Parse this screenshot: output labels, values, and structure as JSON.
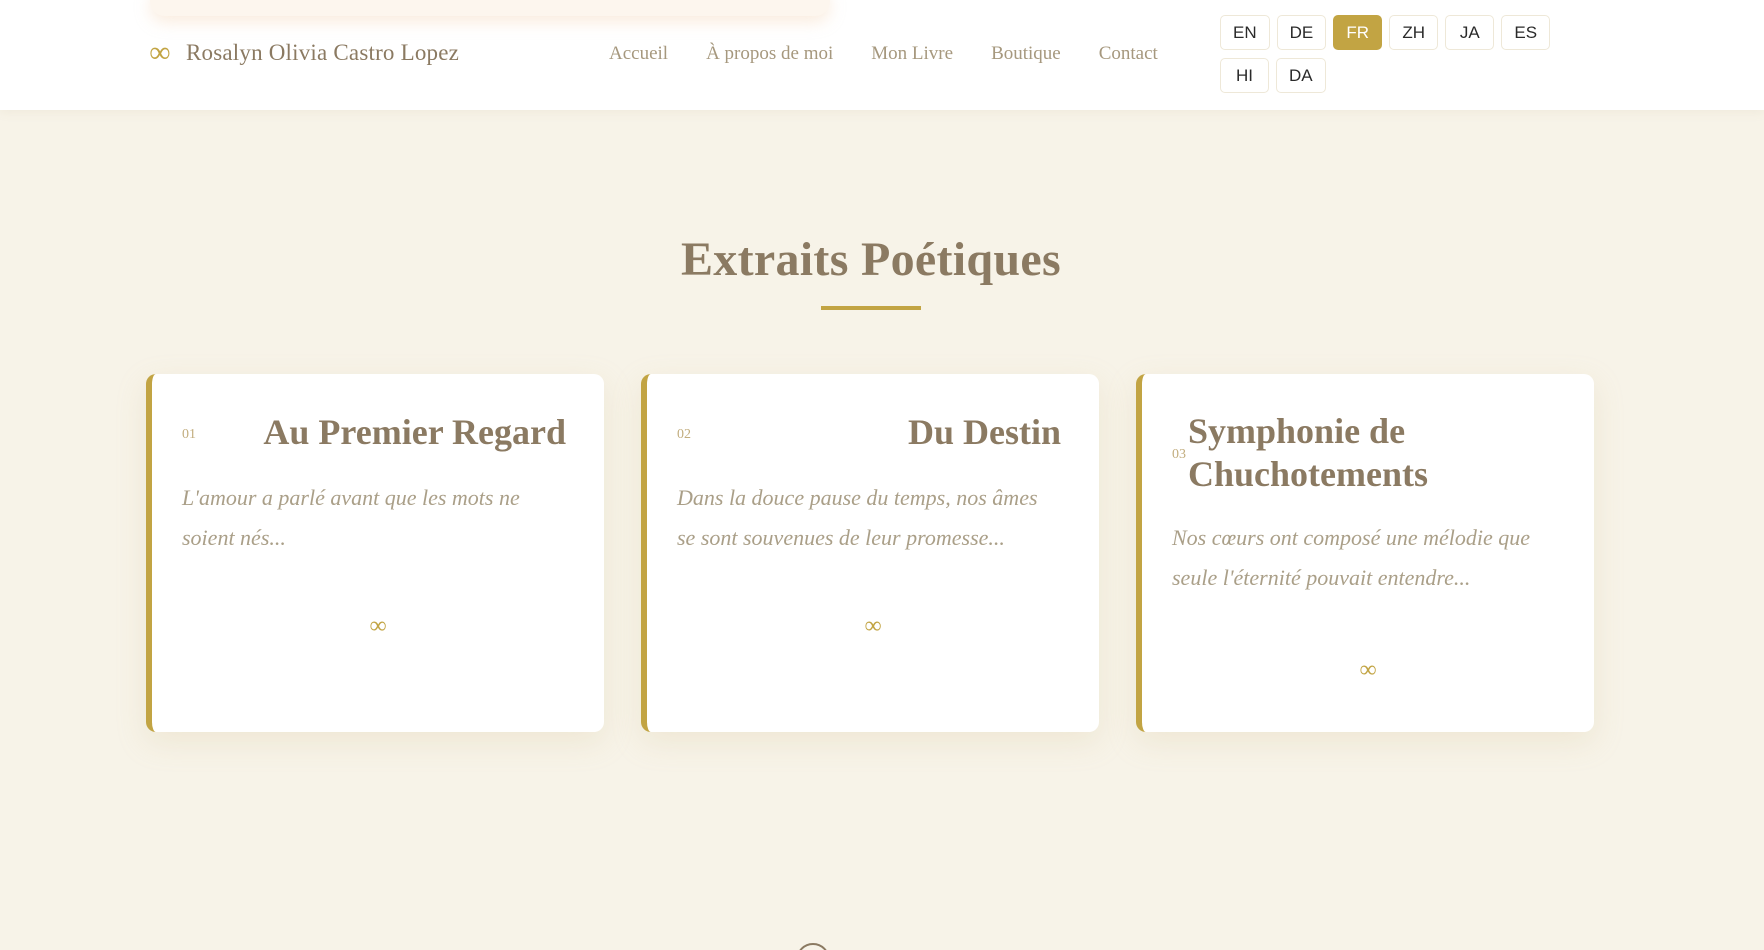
{
  "header": {
    "brand_icon": "infinity-icon",
    "brand_name": "Rosalyn Olivia Castro Lopez",
    "nav": [
      "Accueil",
      "À propos de moi",
      "Mon Livre",
      "Boutique",
      "Contact"
    ],
    "languages": [
      "EN",
      "DE",
      "FR",
      "ZH",
      "JA",
      "ES",
      "HI",
      "DA"
    ],
    "active_language": "FR"
  },
  "section": {
    "title": "Extraits Poétiques",
    "cards": [
      {
        "number": "01",
        "title": "Au Premier Regard",
        "excerpt": "L'amour a parlé avant que les mots ne soient nés...",
        "icon": "infinity-icon"
      },
      {
        "number": "02",
        "title": "Du Destin",
        "excerpt": "Dans la douce pause du temps, nos âmes se sont souvenues de leur promesse...",
        "icon": "infinity-icon"
      },
      {
        "number": "03",
        "title": "Symphonie de Chuchotements",
        "excerpt": "Nos cœurs ont composé une mélodie que seule l'éternité pouvait entendre...",
        "icon": "infinity-icon"
      }
    ]
  },
  "colors": {
    "accent": "#c2a443",
    "background": "#f7f3e8",
    "text": "#8b7a62"
  }
}
